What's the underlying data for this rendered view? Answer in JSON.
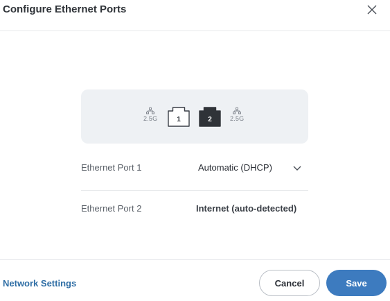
{
  "dialog": {
    "title": "Configure Ethernet Ports",
    "close_icon": "close-icon"
  },
  "ports_panel": {
    "ports": [
      {
        "number": "1",
        "speed": "2.5G",
        "active": false
      },
      {
        "number": "2",
        "speed": "2.5G",
        "active": true
      }
    ]
  },
  "settings": [
    {
      "label": "Ethernet Port 1",
      "value": "Automatic (DHCP)",
      "has_dropdown": true
    },
    {
      "label": "Ethernet Port 2",
      "value": "Internet (auto-detected)",
      "has_dropdown": false
    }
  ],
  "footer": {
    "link_label": "Network Settings",
    "cancel_label": "Cancel",
    "save_label": "Save"
  },
  "colors": {
    "accent": "#3d7bbf",
    "link": "#2f6ea5",
    "panel_bg": "#eef1f4",
    "active_port": "#2f3338"
  }
}
